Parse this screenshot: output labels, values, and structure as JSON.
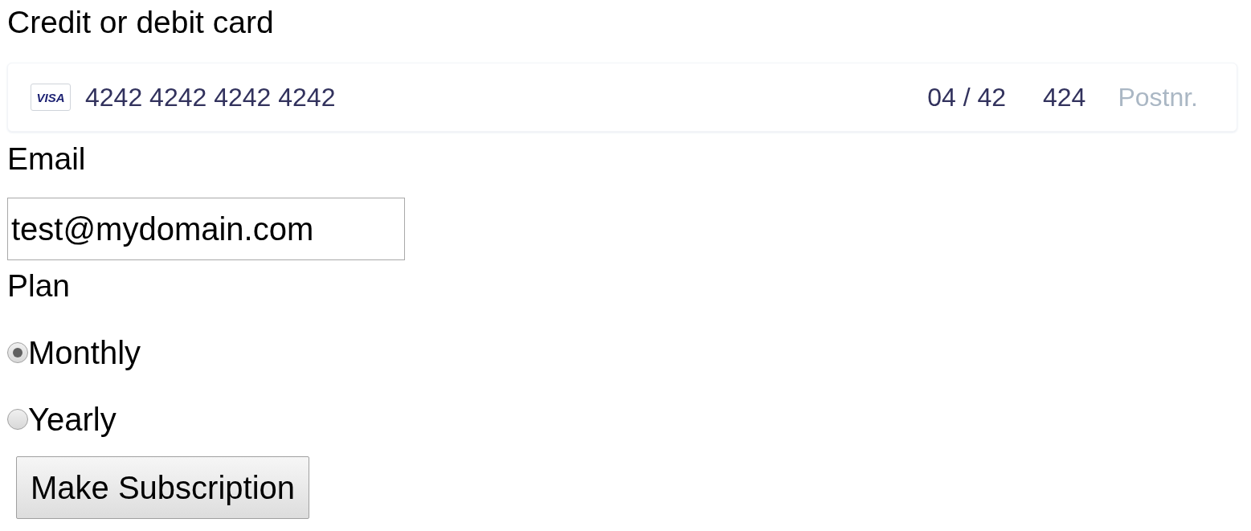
{
  "card_section": {
    "label": "Credit or debit card",
    "brand": "VISA",
    "number": "4242 4242 4242 4242",
    "expiry": "04 / 42",
    "cvc": "424",
    "postal_placeholder": "Postnr."
  },
  "email": {
    "label": "Email",
    "value": "test@mydomain.com"
  },
  "plan": {
    "label": "Plan",
    "options": [
      {
        "label": "Monthly",
        "selected": true
      },
      {
        "label": "Yearly",
        "selected": false
      }
    ]
  },
  "submit": {
    "label": "Make Subscription"
  }
}
